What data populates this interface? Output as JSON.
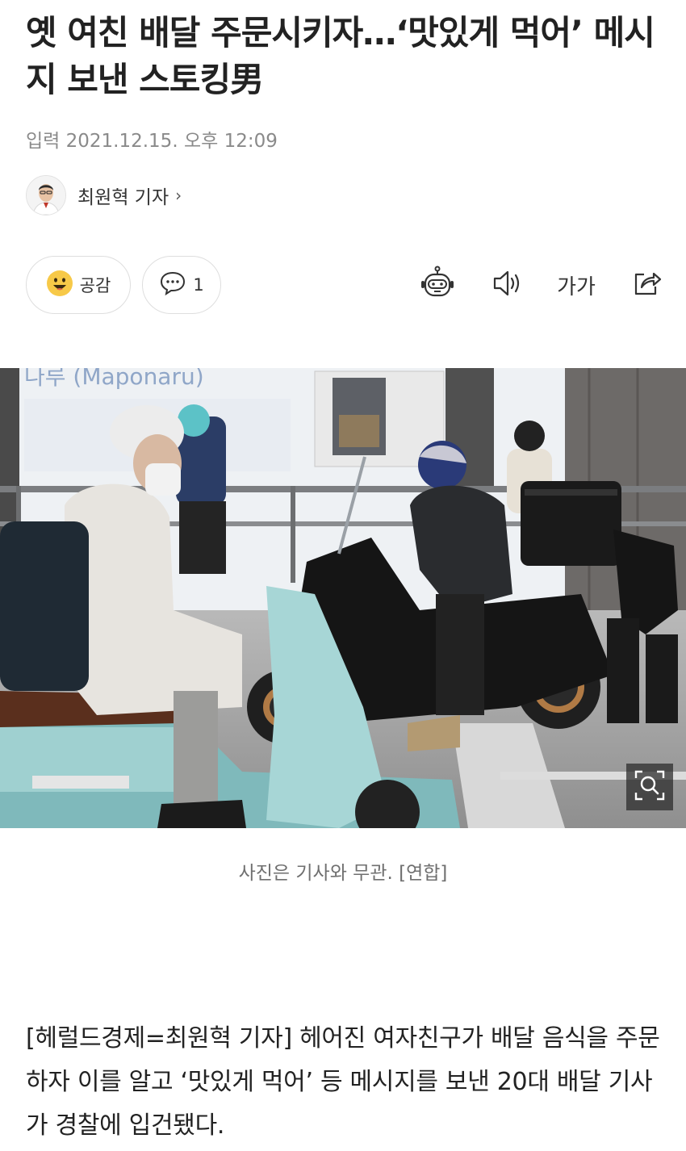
{
  "article": {
    "headline": "옛 여친 배달 주문시키자…‘맛있게 먹어’ 메시지 보낸 스토킹男",
    "date": "입력 2021.12.15. 오후 12:09",
    "reporter": "최원혁 기자",
    "caption": "사진은 기사와 무관. [연합]",
    "body": "[헤럴드경제=최원혁 기자] 헤어진 여자친구가 배달 음식을 주문하자 이를 알고 ‘맛있게 먹어’ 등 메시지를 보낸 20대 배달 기사가 경찰에 입건됐다."
  },
  "actions": {
    "like_label": "공감",
    "comment_count": "1",
    "font_size_label": "가가"
  },
  "photo": {
    "sign_text": "나루 (Maponaru)"
  },
  "icons": {
    "like": "smiley-icon",
    "comment": "speech-bubble-icon",
    "tts_bot": "robot-icon",
    "audio": "speaker-icon",
    "share": "share-icon",
    "zoom": "zoom-icon"
  },
  "colors": {
    "accent_yellow": "#F7C948",
    "text": "#222222",
    "muted": "#8A8A8A"
  }
}
